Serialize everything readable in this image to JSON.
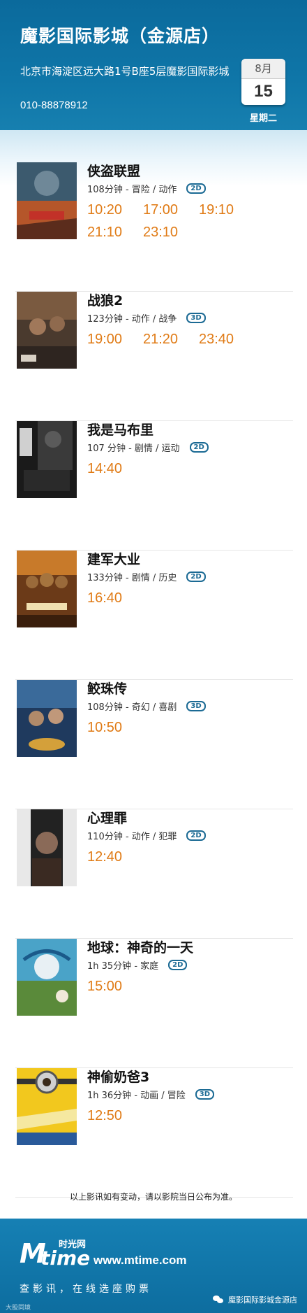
{
  "header": {
    "title": "魔影国际影城（金源店）",
    "address": "北京市海淀区远大路1号B座5层魔影国际影城",
    "phone": "010-88878912",
    "date": {
      "month": "8月",
      "day": "15",
      "weekday": "星期二"
    }
  },
  "movies": [
    {
      "title": "侠盗联盟",
      "info": "108分钟 - 冒险 / 动作",
      "format": "2D",
      "times": [
        "10:20",
        "17:00",
        "19:10",
        "21:10",
        "23:10"
      ]
    },
    {
      "title": "战狼2",
      "info": "123分钟 - 动作 / 战争",
      "format": "3D",
      "times": [
        "19:00",
        "21:20",
        "23:40"
      ]
    },
    {
      "title": "我是马布里",
      "info": "107 分钟 - 剧情 / 运动",
      "format": "2D",
      "times": [
        "14:40"
      ]
    },
    {
      "title": "建军大业",
      "info": "133分钟 - 剧情 / 历史",
      "format": "2D",
      "times": [
        "16:40"
      ]
    },
    {
      "title": "鲛珠传",
      "info": "108分钟 - 奇幻 / 喜剧",
      "format": "3D",
      "times": [
        "10:50"
      ]
    },
    {
      "title": "心理罪",
      "info": "110分钟 - 动作 / 犯罪",
      "format": "2D",
      "times": [
        "12:40"
      ]
    },
    {
      "title": "地球：神奇的一天",
      "info": "1h 35分钟 - 家庭",
      "format": "2D",
      "times": [
        "15:00"
      ]
    },
    {
      "title": "神偷奶爸3",
      "info": "1h 36分钟 - 动画 / 冒险",
      "format": "3D",
      "times": [
        "12:50"
      ]
    }
  ],
  "notice": "以上影讯如有变动，请以影院当日公布为准。",
  "footer": {
    "logo_m": "M",
    "logo_time": "time",
    "logo_cn": "时光网",
    "site": "www.mtime.com",
    "slogan": "查影讯，在线选座购票",
    "wechat_account": "魔影国际影城金源店",
    "watermark": "大股同境"
  },
  "colors": {
    "header_bg": "#0f76a8",
    "showtime": "#e07b16",
    "badge": "#1b6a94"
  }
}
